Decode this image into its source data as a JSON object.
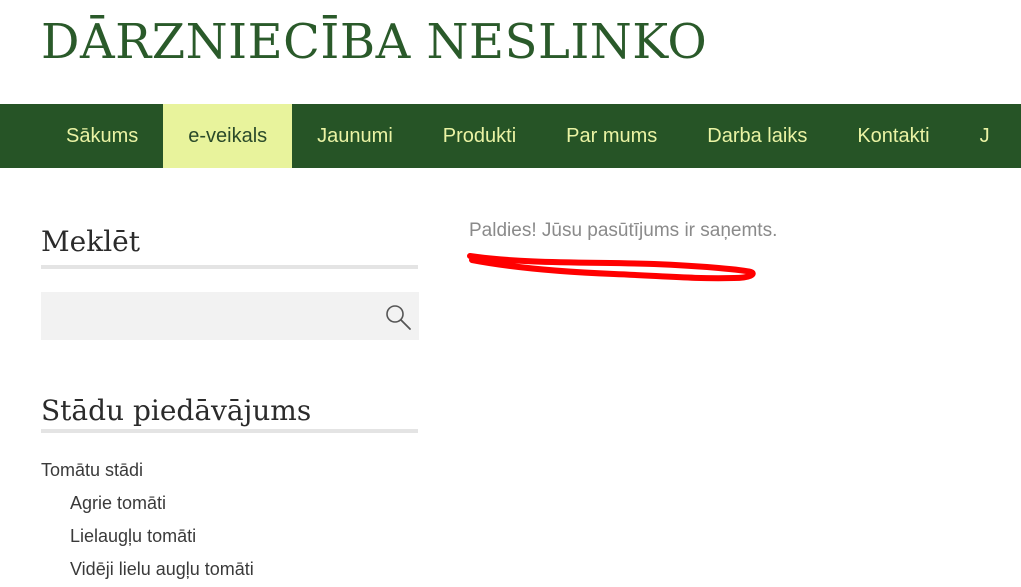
{
  "site": {
    "title": "DĀRZNIECĪBA NESLINKO"
  },
  "nav": {
    "items": [
      "Sākums",
      "e-veikals",
      "Jaunumi",
      "Produkti",
      "Par mums",
      "Darba laiks",
      "Kontakti",
      "J"
    ],
    "active_index": 1
  },
  "sidebar": {
    "search_title": "Meklēt",
    "search_value": "",
    "offer_title": "Stādu piedāvājums",
    "categories": [
      {
        "label": "Tomātu stādi",
        "level": 0
      },
      {
        "label": "Agrie tomāti",
        "level": 1
      },
      {
        "label": "Lielaugļu tomāti",
        "level": 1
      },
      {
        "label": "Vidēji lielu augļu tomāti",
        "level": 1
      }
    ]
  },
  "main": {
    "message": "Paldies! Jūsu pasūtījums ir saņemts."
  },
  "colors": {
    "brand_green": "#265426",
    "title_green": "#2a5a2a",
    "active_tab": "#e8f39c",
    "nav_text": "#eaf3a4",
    "annotation_red": "#ff0000"
  },
  "icons": {
    "search": "search-icon"
  }
}
